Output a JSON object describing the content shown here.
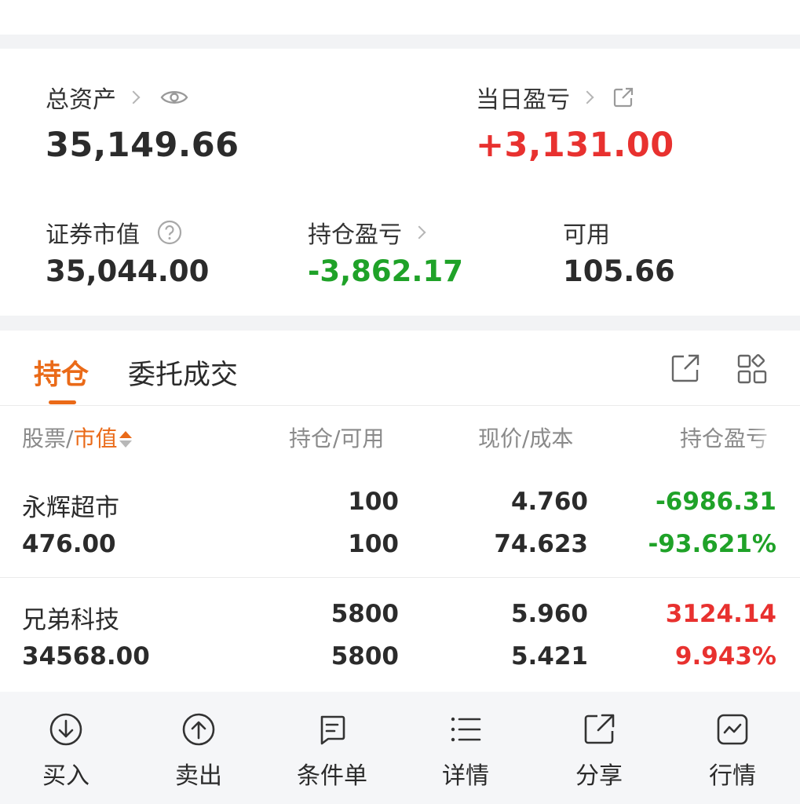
{
  "summary": {
    "total_assets_label": "总资产",
    "total_assets_value": "35,149.66",
    "daily_pnl_label": "当日盈亏",
    "daily_pnl_value": "+3,131.00",
    "securities_value_label": "证券市值",
    "securities_value": "35,044.00",
    "position_pnl_label": "持仓盈亏",
    "position_pnl_value": "-3,862.17",
    "available_label": "可用",
    "available_value": "105.66"
  },
  "tabs": [
    {
      "label": "持仓",
      "active": true
    },
    {
      "label": "委托成交",
      "active": false
    }
  ],
  "table": {
    "headers": {
      "stock": "股票",
      "sep1": "/",
      "market_value": "市值",
      "position": "持仓/可用",
      "price": "现价/成本",
      "pnl": "持仓盈亏"
    },
    "rows": [
      {
        "name": "永辉超市",
        "market_value": "476.00",
        "position": "100",
        "available": "100",
        "price": "4.760",
        "cost": "74.623",
        "pnl": "-6986.31",
        "pnl_pct": "-93.621%",
        "direction": "down"
      },
      {
        "name": "兄弟科技",
        "market_value": "34568.00",
        "position": "5800",
        "available": "5800",
        "price": "5.960",
        "cost": "5.421",
        "pnl": "3124.14",
        "pnl_pct": "9.943%",
        "direction": "up"
      }
    ]
  },
  "toolbar": [
    {
      "label": "买入",
      "icon": "buy-icon"
    },
    {
      "label": "卖出",
      "icon": "sell-icon"
    },
    {
      "label": "条件单",
      "icon": "conditional-order-icon"
    },
    {
      "label": "详情",
      "icon": "details-list-icon"
    },
    {
      "label": "分享",
      "icon": "share-icon"
    },
    {
      "label": "行情",
      "icon": "market-chart-icon"
    }
  ],
  "colors": {
    "accent": "#ea6a18",
    "up": "#e8312f",
    "down": "#1fa228",
    "background_gap": "#f2f3f5",
    "toolbar_bg": "#f5f6f8"
  }
}
